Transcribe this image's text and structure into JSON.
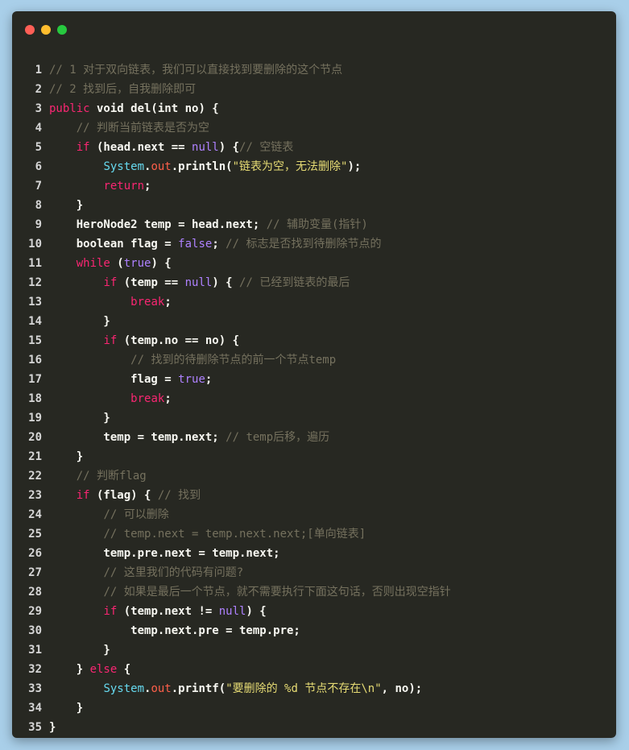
{
  "colors": {
    "background": "#a9cfe9",
    "editor": "#272822",
    "plain": "#f8f8f2",
    "comment": "#75715e",
    "keyword": "#f92672",
    "literal": "#ae81ff",
    "type": "#66d9ef",
    "field": "#fd5f4a",
    "string": "#e6db74",
    "line_number": "#d6d6d6",
    "window_close": "#ff5f56",
    "window_minimize": "#ffbd2e",
    "window_maximize": "#27c93f"
  },
  "window_controls": [
    "close-dot",
    "minimize-dot",
    "maximize-dot"
  ],
  "code_lines": [
    {
      "n": "1",
      "tokens": [
        {
          "t": "// 1 对于双向链表，我们可以直接找到要删除的这个节点",
          "k": "comment"
        }
      ]
    },
    {
      "n": "2",
      "tokens": [
        {
          "t": "// 2 找到后，自我删除即可",
          "k": "comment"
        }
      ]
    },
    {
      "n": "3",
      "tokens": [
        {
          "t": "public",
          "k": "keyword"
        },
        {
          "t": " void del(int no) {",
          "k": "plain"
        }
      ]
    },
    {
      "n": "4",
      "tokens": [
        {
          "t": "    ",
          "k": "plain"
        },
        {
          "t": "// 判断当前链表是否为空",
          "k": "comment"
        }
      ]
    },
    {
      "n": "5",
      "tokens": [
        {
          "t": "    ",
          "k": "plain"
        },
        {
          "t": "if",
          "k": "keyword"
        },
        {
          "t": " (head.next == ",
          "k": "plain"
        },
        {
          "t": "null",
          "k": "literal"
        },
        {
          "t": ") {",
          "k": "plain"
        },
        {
          "t": "// 空链表",
          "k": "comment"
        }
      ]
    },
    {
      "n": "6",
      "tokens": [
        {
          "t": "        ",
          "k": "plain"
        },
        {
          "t": "System",
          "k": "type"
        },
        {
          "t": ".",
          "k": "plain"
        },
        {
          "t": "out",
          "k": "field"
        },
        {
          "t": ".println(",
          "k": "plain"
        },
        {
          "t": "\"链表为空，无法删除\"",
          "k": "string"
        },
        {
          "t": ");",
          "k": "plain"
        }
      ]
    },
    {
      "n": "7",
      "tokens": [
        {
          "t": "        ",
          "k": "plain"
        },
        {
          "t": "return",
          "k": "keyword"
        },
        {
          "t": ";",
          "k": "plain"
        }
      ]
    },
    {
      "n": "8",
      "tokens": [
        {
          "t": "    }",
          "k": "plain"
        }
      ]
    },
    {
      "n": "9",
      "tokens": [
        {
          "t": "    HeroNode2 temp = head.next; ",
          "k": "plain"
        },
        {
          "t": "// 辅助变量(指针)",
          "k": "comment"
        }
      ]
    },
    {
      "n": "10",
      "tokens": [
        {
          "t": "    boolean flag = ",
          "k": "plain"
        },
        {
          "t": "false",
          "k": "literal"
        },
        {
          "t": "; ",
          "k": "plain"
        },
        {
          "t": "// 标志是否找到待删除节点的",
          "k": "comment"
        }
      ]
    },
    {
      "n": "11",
      "tokens": [
        {
          "t": "    ",
          "k": "plain"
        },
        {
          "t": "while",
          "k": "keyword"
        },
        {
          "t": " (",
          "k": "plain"
        },
        {
          "t": "true",
          "k": "literal"
        },
        {
          "t": ") {",
          "k": "plain"
        }
      ]
    },
    {
      "n": "12",
      "tokens": [
        {
          "t": "        ",
          "k": "plain"
        },
        {
          "t": "if",
          "k": "keyword"
        },
        {
          "t": " (temp == ",
          "k": "plain"
        },
        {
          "t": "null",
          "k": "literal"
        },
        {
          "t": ") { ",
          "k": "plain"
        },
        {
          "t": "// 已经到链表的最后",
          "k": "comment"
        }
      ]
    },
    {
      "n": "13",
      "tokens": [
        {
          "t": "            ",
          "k": "plain"
        },
        {
          "t": "break",
          "k": "keyword"
        },
        {
          "t": ";",
          "k": "plain"
        }
      ]
    },
    {
      "n": "14",
      "tokens": [
        {
          "t": "        }",
          "k": "plain"
        }
      ]
    },
    {
      "n": "15",
      "tokens": [
        {
          "t": "        ",
          "k": "plain"
        },
        {
          "t": "if",
          "k": "keyword"
        },
        {
          "t": " (temp.no == no) {",
          "k": "plain"
        }
      ]
    },
    {
      "n": "16",
      "tokens": [
        {
          "t": "            ",
          "k": "plain"
        },
        {
          "t": "// 找到的待删除节点的前一个节点temp",
          "k": "comment"
        }
      ]
    },
    {
      "n": "17",
      "tokens": [
        {
          "t": "            flag = ",
          "k": "plain"
        },
        {
          "t": "true",
          "k": "literal"
        },
        {
          "t": ";",
          "k": "plain"
        }
      ]
    },
    {
      "n": "18",
      "tokens": [
        {
          "t": "            ",
          "k": "plain"
        },
        {
          "t": "break",
          "k": "keyword"
        },
        {
          "t": ";",
          "k": "plain"
        }
      ]
    },
    {
      "n": "19",
      "tokens": [
        {
          "t": "        }",
          "k": "plain"
        }
      ]
    },
    {
      "n": "20",
      "tokens": [
        {
          "t": "        temp = temp.next; ",
          "k": "plain"
        },
        {
          "t": "// temp后移，遍历",
          "k": "comment"
        }
      ]
    },
    {
      "n": "21",
      "tokens": [
        {
          "t": "    }",
          "k": "plain"
        }
      ]
    },
    {
      "n": "22",
      "tokens": [
        {
          "t": "    ",
          "k": "plain"
        },
        {
          "t": "// 判断flag",
          "k": "comment"
        }
      ]
    },
    {
      "n": "23",
      "tokens": [
        {
          "t": "    ",
          "k": "plain"
        },
        {
          "t": "if",
          "k": "keyword"
        },
        {
          "t": " (flag) { ",
          "k": "plain"
        },
        {
          "t": "// 找到",
          "k": "comment"
        }
      ]
    },
    {
      "n": "24",
      "tokens": [
        {
          "t": "        ",
          "k": "plain"
        },
        {
          "t": "// 可以删除",
          "k": "comment"
        }
      ]
    },
    {
      "n": "25",
      "tokens": [
        {
          "t": "        ",
          "k": "plain"
        },
        {
          "t": "// temp.next = temp.next.next;[单向链表]",
          "k": "comment"
        }
      ]
    },
    {
      "n": "26",
      "tokens": [
        {
          "t": "        temp.pre.next = temp.next;",
          "k": "plain"
        }
      ]
    },
    {
      "n": "27",
      "tokens": [
        {
          "t": "        ",
          "k": "plain"
        },
        {
          "t": "// 这里我们的代码有问题?",
          "k": "comment"
        }
      ]
    },
    {
      "n": "28",
      "tokens": [
        {
          "t": "        ",
          "k": "plain"
        },
        {
          "t": "// 如果是最后一个节点，就不需要执行下面这句话，否则出现空指针",
          "k": "comment"
        }
      ]
    },
    {
      "n": "29",
      "tokens": [
        {
          "t": "        ",
          "k": "plain"
        },
        {
          "t": "if",
          "k": "keyword"
        },
        {
          "t": " (temp.next != ",
          "k": "plain"
        },
        {
          "t": "null",
          "k": "literal"
        },
        {
          "t": ") {",
          "k": "plain"
        }
      ]
    },
    {
      "n": "30",
      "tokens": [
        {
          "t": "            temp.next.pre = temp.pre;",
          "k": "plain"
        }
      ]
    },
    {
      "n": "31",
      "tokens": [
        {
          "t": "        }",
          "k": "plain"
        }
      ]
    },
    {
      "n": "32",
      "tokens": [
        {
          "t": "    } ",
          "k": "plain"
        },
        {
          "t": "else",
          "k": "keyword"
        },
        {
          "t": " {",
          "k": "plain"
        }
      ]
    },
    {
      "n": "33",
      "tokens": [
        {
          "t": "        ",
          "k": "plain"
        },
        {
          "t": "System",
          "k": "type"
        },
        {
          "t": ".",
          "k": "plain"
        },
        {
          "t": "out",
          "k": "field"
        },
        {
          "t": ".printf(",
          "k": "plain"
        },
        {
          "t": "\"要删除的 %d 节点不存在\\n\"",
          "k": "string"
        },
        {
          "t": ", no);",
          "k": "plain"
        }
      ]
    },
    {
      "n": "34",
      "tokens": [
        {
          "t": "    }",
          "k": "plain"
        }
      ]
    },
    {
      "n": "35",
      "tokens": [
        {
          "t": "}",
          "k": "plain"
        }
      ]
    }
  ]
}
